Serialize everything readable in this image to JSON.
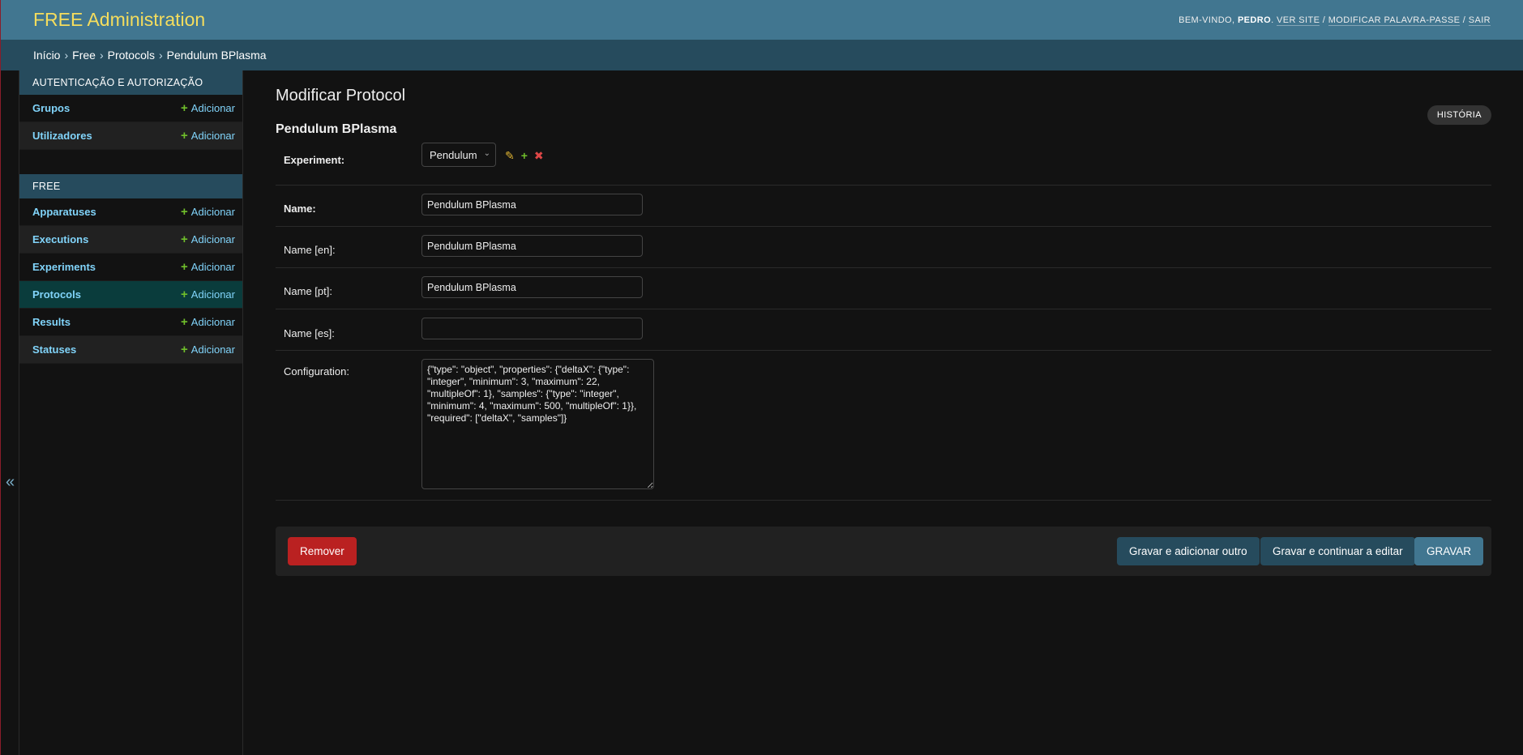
{
  "header": {
    "brand": "FREE Administration",
    "welcome": "BEM-VINDO, ",
    "username": "PEDRO",
    "links": [
      "VER SITE",
      "MODIFICAR PALAVRA-PASSE",
      "SAIR"
    ]
  },
  "breadcrumbs": [
    "Início",
    "Free",
    "Protocols",
    "Pendulum BPlasma"
  ],
  "sidebar": {
    "toggle": "«",
    "modules": [
      {
        "caption": "AUTENTICAÇÃO E AUTORIZAÇÃO",
        "models": [
          {
            "name": "Grupos",
            "add": "Adicionar"
          },
          {
            "name": "Utilizadores",
            "add": "Adicionar"
          }
        ]
      },
      {
        "caption": "FREE",
        "models": [
          {
            "name": "Apparatuses",
            "add": "Adicionar"
          },
          {
            "name": "Executions",
            "add": "Adicionar"
          },
          {
            "name": "Experiments",
            "add": "Adicionar"
          },
          {
            "name": "Protocols",
            "add": "Adicionar",
            "active": true
          },
          {
            "name": "Results",
            "add": "Adicionar"
          },
          {
            "name": "Statuses",
            "add": "Adicionar"
          }
        ]
      }
    ]
  },
  "main": {
    "page_title": "Modificar Protocol",
    "object_title": "Pendulum BPlasma",
    "history_button": "HISTÓRIA",
    "fields": {
      "experiment": {
        "label": "Experiment:",
        "value": "Pendulum"
      },
      "name": {
        "label": "Name:",
        "value": "Pendulum BPlasma"
      },
      "name_en": {
        "label": "Name [en]:",
        "value": "Pendulum BPlasma"
      },
      "name_pt": {
        "label": "Name [pt]:",
        "value": "Pendulum BPlasma"
      },
      "name_es": {
        "label": "Name [es]:",
        "value": ""
      },
      "configuration": {
        "label": "Configuration:",
        "value": "{\"type\": \"object\", \"properties\": {\"deltaX\": {\"type\": \"integer\", \"minimum\": 3, \"maximum\": 22, \"multipleOf\": 1}, \"samples\": {\"type\": \"integer\", \"minimum\": 4, \"maximum\": 500, \"multipleOf\": 1}}, \"required\": [\"deltaX\", \"samples\"]}"
      }
    },
    "buttons": {
      "delete": "Remover",
      "save_add_another": "Gravar e adicionar outro",
      "save_continue": "Gravar e continuar a editar",
      "save": "GRAVAR"
    }
  },
  "colors": {
    "header_bg": "#417690",
    "brand": "#f5dd5d",
    "breadcrumb_bg": "#264b5d",
    "link": "#81d4fa",
    "add_icon": "#70bf2b",
    "delete": "#ba2121",
    "body_bg": "#121212"
  }
}
